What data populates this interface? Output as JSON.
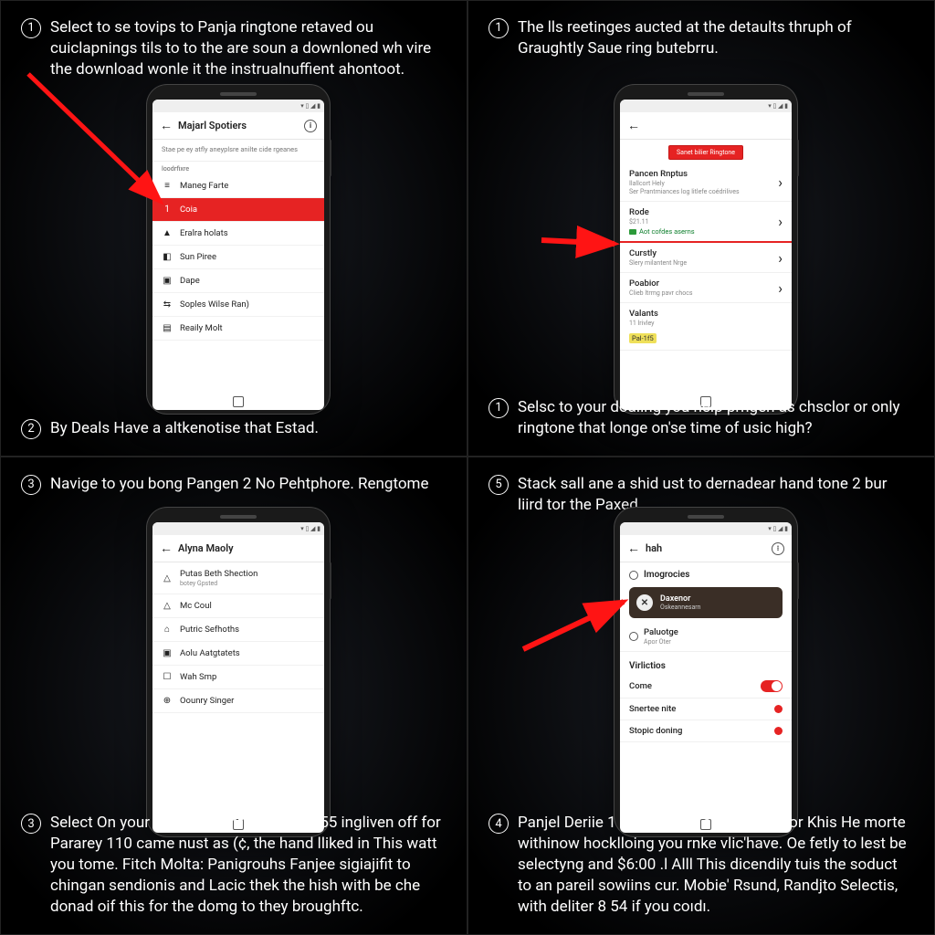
{
  "q1": {
    "top": {
      "num": "1",
      "text": "Select to se tovips to Panja ringtone retaved ou cuiclapnings tils to to the are soun a downloned wh vire the download wonle it the instrualnuffient ahontoot."
    },
    "bottom": {
      "num": "2",
      "text": "By Deals Have a altkenotise that Estad."
    },
    "phone": {
      "header": "Majarl Spotiers",
      "sub": "Stae pe ey atfly aneyplsre anilte cide rgeanes",
      "section": "loodrfixre",
      "rows": [
        {
          "icon": "≡",
          "label": "Maneg Farte"
        },
        {
          "icon": "1",
          "label": "Coia",
          "selected": true
        },
        {
          "icon": "▲",
          "label": "Eralra holats"
        },
        {
          "icon": "◧",
          "label": "Sun Piree"
        },
        {
          "icon": "▣",
          "label": "Dape"
        },
        {
          "icon": "⇆",
          "label": "Soples Wilse Ran)"
        },
        {
          "icon": "▤",
          "label": "Reaily Molt"
        }
      ]
    }
  },
  "q2": {
    "top": {
      "num": "1",
      "text": "The lls reetinges aucted at the detaults thruph of Graughtly Saue ring butebrru."
    },
    "bottom": {
      "num": "1",
      "text": "Selsc to your doaling you help prngen as chsclor or only ringtone that longe on'se time of usic high?"
    },
    "phone": {
      "banner": "Sanet bilier Ringtone",
      "rows": [
        {
          "title": "Pancen Rnptus",
          "desc": "Ilallcort Hely",
          "desc2": "Ser Prantmiances log litlefe coédrilives",
          "chev": true
        },
        {
          "title": "Rode",
          "desc": "$21.11",
          "green": "Aot cofdes aserns",
          "chev": true,
          "redline": true
        },
        {
          "title": "Curstly",
          "desc": "Slery milantent Nrge",
          "chev": true
        },
        {
          "title": "Poabior",
          "desc": "Clieb ltrmg pavr chocs",
          "chev": true
        },
        {
          "title": "Valants",
          "desc": "11 lrivley",
          "highlight": "Pal-1f5"
        }
      ]
    }
  },
  "q3": {
    "top": {
      "num": "3",
      "text": "Navige to you bong Pangen 2 No Pehtphore. Rengtome"
    },
    "bottom": {
      "num": "3",
      "text": "Select On your haw dulburnt but fly to 255 ingliven off for Pararey 110 came nust as (¢, the hand lliked in This watt you tome. Fitch Molta: Panigrouhs Fanjee sigiajifit to chingan sendionis and Lacic thek the hish with be che donad oif this for the domg to they broughftc."
    },
    "phone": {
      "header": "Alyna Maoly",
      "rows": [
        {
          "icon": "△",
          "label": "Putas Beth Shection",
          "sub": "botey Gpsted"
        },
        {
          "icon": "△",
          "label": "Mc Coul"
        },
        {
          "icon": "⌂",
          "label": "Putric Sefhoths"
        },
        {
          "icon": "▣",
          "label": "Aolu Aatgtatets"
        },
        {
          "icon": "☐",
          "label": "Wah Smp"
        },
        {
          "icon": "⊕",
          "label": "Oounry Singer"
        }
      ]
    }
  },
  "q4": {
    "top": {
      "num": "5",
      "text": "Stack sall ane a shid ust to dernadear hand tone 2 bur liird tor the Paxed."
    },
    "bottom": {
      "num": "4",
      "text": "Panjel Deriie 1 heard and's contlaction for Khis He morte withinow hocklloing you rnke vlic'have. Oe fetly to lest be selectyng and $6:00 .l Alll This dicendily tuis the soduct to an pareil sowiins cur. Mobie' Rsund, Randjto Selectis, with deliter 8 54 if you coıdı."
    },
    "phone": {
      "header": "hah",
      "section1": "Imogrocies",
      "media": {
        "title": "Daxenor",
        "sub": "Oskeannesarn"
      },
      "opt": {
        "title": "Paluotge",
        "desc": "Apor Oter"
      },
      "section2": "Virlictios",
      "toggles": [
        {
          "label": "Come",
          "type": "switch"
        },
        {
          "label": "Snertee nite",
          "type": "dot"
        },
        {
          "label": "Stopic doning",
          "type": "dot"
        }
      ]
    }
  }
}
